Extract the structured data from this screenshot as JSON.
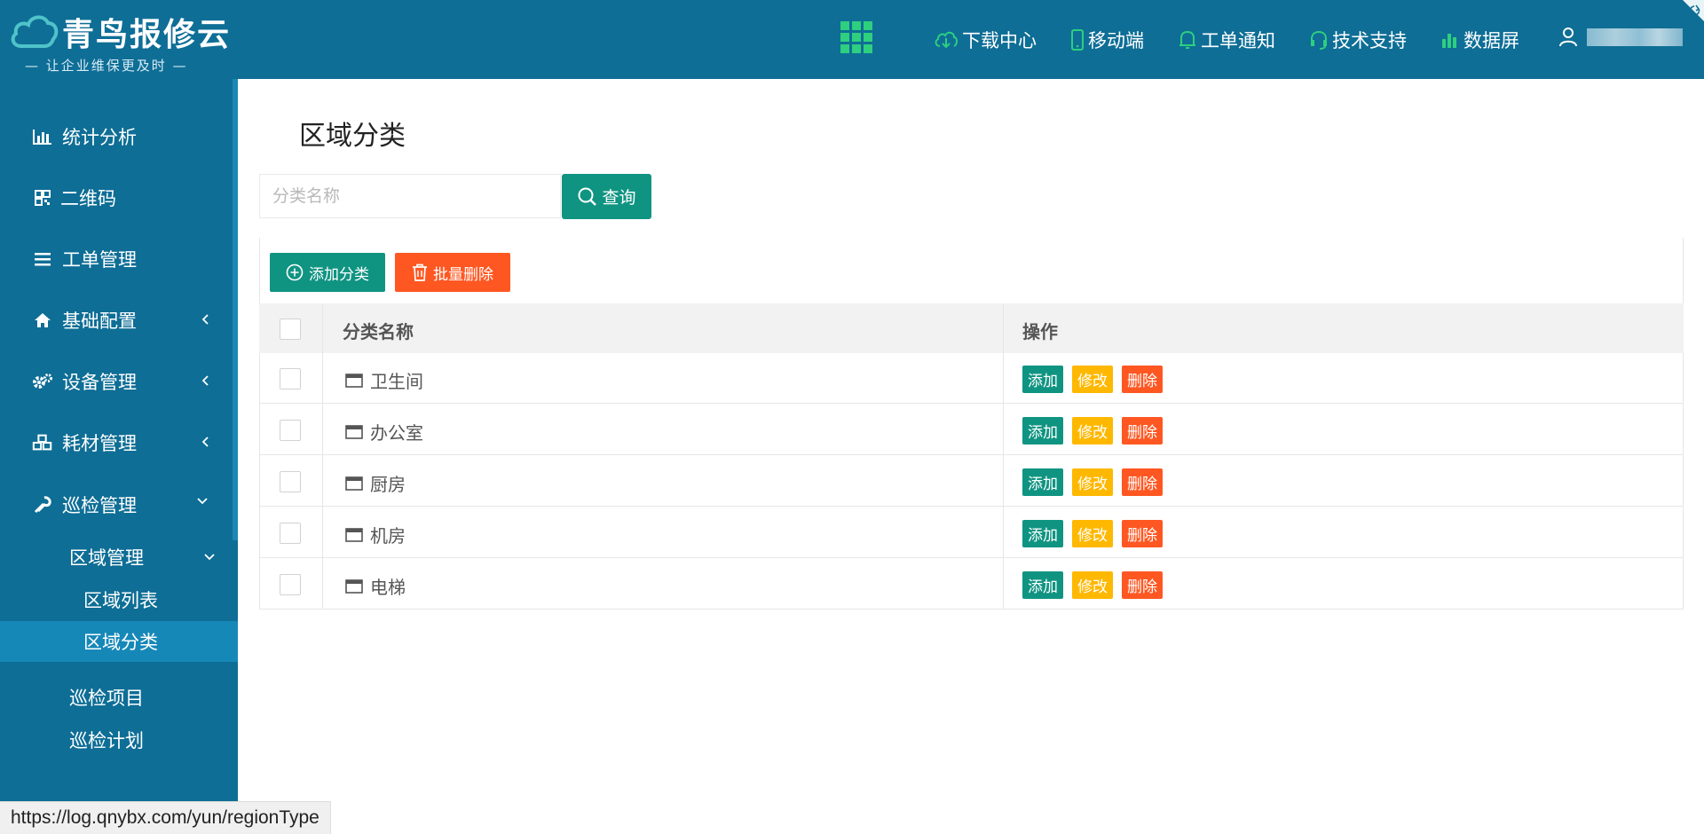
{
  "brand": {
    "name": "青鸟报修云",
    "slogan": "— 让企业维保更及时 —"
  },
  "header": {
    "nav": [
      {
        "label": "下载中心",
        "icon": "cloud-download-icon"
      },
      {
        "label": "移动端",
        "icon": "mobile-icon"
      },
      {
        "label": "工单通知",
        "icon": "bell-icon"
      },
      {
        "label": "技术支持",
        "icon": "headset-icon"
      },
      {
        "label": "数据屏",
        "icon": "bar-chart-icon"
      }
    ],
    "user_icon": "user-icon"
  },
  "sidebar": {
    "items": [
      {
        "label": "统计分析",
        "icon": "bar-chart-icon"
      },
      {
        "label": "二维码",
        "icon": "qrcode-icon"
      },
      {
        "label": "工单管理",
        "icon": "list-icon"
      },
      {
        "label": "基础配置",
        "icon": "home-icon",
        "expandable": true
      },
      {
        "label": "设备管理",
        "icon": "gears-icon",
        "expandable": true
      },
      {
        "label": "耗材管理",
        "icon": "cubes-icon",
        "expandable": true
      },
      {
        "label": "巡检管理",
        "icon": "wrench-icon",
        "expanded": true
      }
    ],
    "submenu": {
      "group": "区域管理",
      "children": [
        "区域列表",
        "区域分类"
      ],
      "active": "区域分类",
      "others": [
        "巡检项目",
        "巡检计划"
      ]
    }
  },
  "main": {
    "title": "区域分类",
    "search": {
      "placeholder": "分类名称",
      "value": "",
      "button": "查询"
    },
    "toolbar": {
      "add": "添加分类",
      "bulk_delete": "批量删除"
    },
    "table": {
      "columns": [
        "分类名称",
        "操作"
      ],
      "rows": [
        {
          "name": "卫生间"
        },
        {
          "name": "办公室"
        },
        {
          "name": "厨房"
        },
        {
          "name": "机房"
        },
        {
          "name": "电梯"
        }
      ],
      "actions": {
        "add": "添加",
        "edit": "修改",
        "delete": "删除"
      }
    }
  },
  "statusbar": {
    "url": "https://log.qnybx.com/yun/regionType"
  },
  "colors": {
    "primary": "#0e6e96",
    "teal": "#109482",
    "warn": "#ffb800",
    "danger": "#ff5722",
    "active": "#1688b8"
  }
}
